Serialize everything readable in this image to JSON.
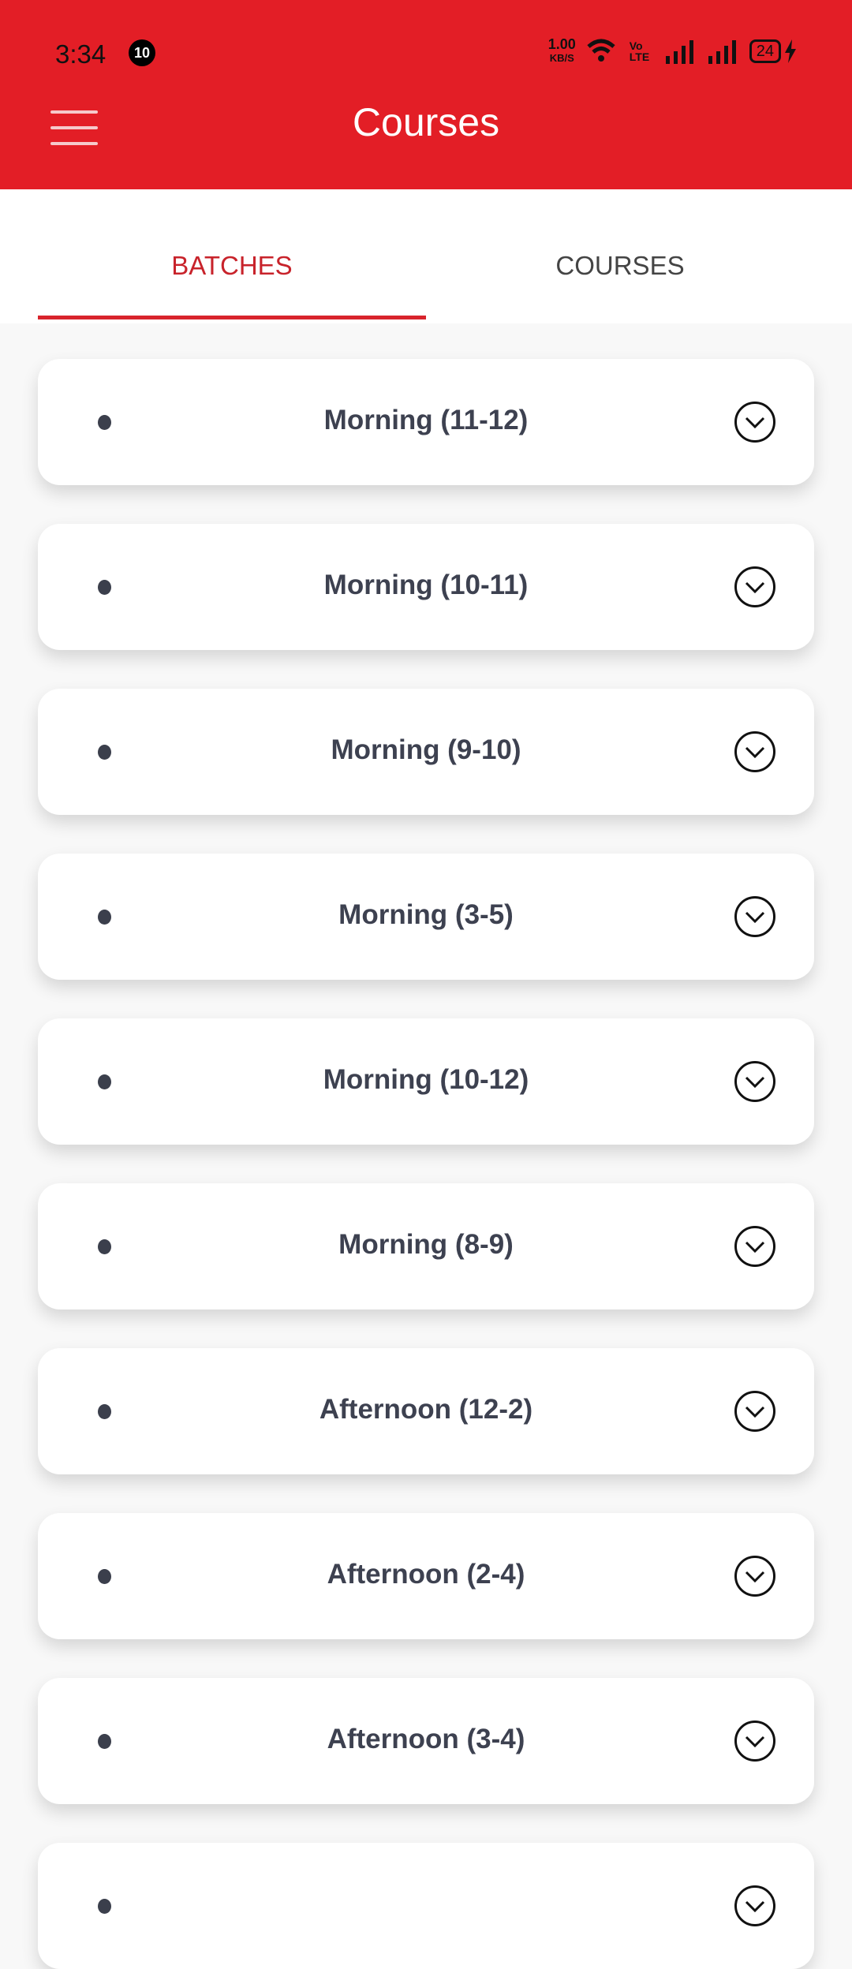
{
  "status_bar": {
    "time": "3:34",
    "notification_count": "10",
    "net_speed": "1.00",
    "net_unit": "KB/S",
    "volte": "Vo LTE",
    "battery": "24"
  },
  "header": {
    "title": "Courses",
    "menu_icon": "hamburger-icon"
  },
  "tabs": [
    {
      "label": "BATCHES",
      "active": true
    },
    {
      "label": "COURSES",
      "active": false
    }
  ],
  "colors": {
    "accent": "#e31e26",
    "tab_active": "#c8232b",
    "text": "#3d4150"
  },
  "batches": [
    {
      "label": "Morning (11-12)"
    },
    {
      "label": "Morning (10-11)"
    },
    {
      "label": "Morning (9-10)"
    },
    {
      "label": "Morning (3-5)"
    },
    {
      "label": "Morning (10-12)"
    },
    {
      "label": "Morning (8-9)"
    },
    {
      "label": "Afternoon (12-2)"
    },
    {
      "label": "Afternoon (2-4)"
    },
    {
      "label": "Afternoon (3-4)"
    },
    {
      "label": ""
    }
  ]
}
